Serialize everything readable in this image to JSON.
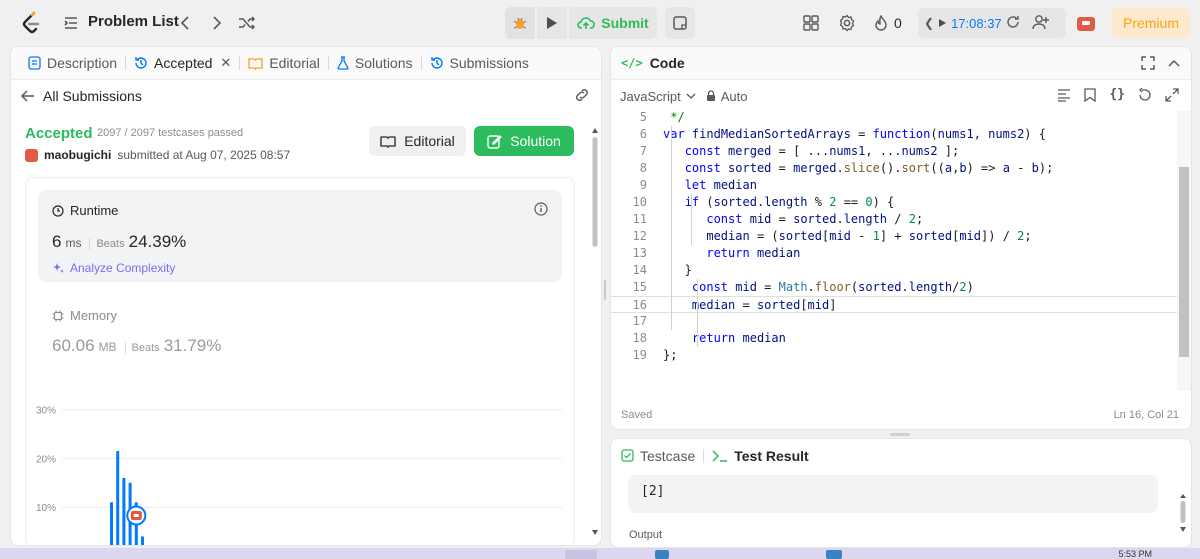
{
  "topbar": {
    "problem_list": "Problem List",
    "submit": "Submit",
    "streak_count": "0",
    "timer": "17:08:37",
    "premium": "Premium"
  },
  "left": {
    "tabs": [
      {
        "label": "Description"
      },
      {
        "label": "Accepted"
      },
      {
        "label": "Editorial"
      },
      {
        "label": "Solutions"
      },
      {
        "label": "Submissions"
      }
    ],
    "all_submissions": "All Submissions",
    "status": "Accepted",
    "testcases": "2097 / 2097 testcases passed",
    "username": "maobugichi",
    "submitted_at": "submitted at Aug 07, 2025 08:57",
    "editorial_btn": "Editorial",
    "solution_btn": "Solution",
    "runtime": {
      "title": "Runtime",
      "value": "6",
      "unit": "ms",
      "beats_label": "Beats",
      "beats": "24.39%",
      "analyze": "Analyze Complexity"
    },
    "memory": {
      "title": "Memory",
      "value": "60.06",
      "unit": "MB",
      "beats_label": "Beats",
      "beats": "31.79%"
    }
  },
  "chart_data": {
    "type": "bar",
    "y_ticks": [
      "30%",
      "20%",
      "10%"
    ],
    "ylim": [
      0,
      30
    ],
    "values": [
      11,
      21.5,
      16,
      15,
      11,
      4,
      1
    ],
    "your_submission_index": 4,
    "color": "#007aff"
  },
  "code": {
    "title": "Code",
    "language": "JavaScript",
    "mode": "Auto",
    "saved": "Saved",
    "position": "Ln 16, Col 21",
    "lines": [
      {
        "n": "5",
        "text": " */"
      },
      {
        "n": "6",
        "text": "var findMedianSortedArrays = function(nums1, nums2) {"
      },
      {
        "n": "7",
        "text": "   const merged = [ ...nums1, ...nums2 ];"
      },
      {
        "n": "8",
        "text": "   const sorted = merged.slice().sort((a,b) => a - b);"
      },
      {
        "n": "9",
        "text": "   let median"
      },
      {
        "n": "10",
        "text": "   if (sorted.length % 2 == 0) {"
      },
      {
        "n": "11",
        "text": "      const mid = sorted.length / 2;"
      },
      {
        "n": "12",
        "text": "      median = (sorted[mid - 1] + sorted[mid]) / 2;"
      },
      {
        "n": "13",
        "text": "      return median"
      },
      {
        "n": "14",
        "text": "   }"
      },
      {
        "n": "15",
        "text": "    const mid = Math.floor(sorted.length/2)"
      },
      {
        "n": "16",
        "text": "    median = sorted[mid]"
      },
      {
        "n": "17",
        "text": ""
      },
      {
        "n": "18",
        "text": "    return median"
      },
      {
        "n": "19",
        "text": "};"
      }
    ]
  },
  "test": {
    "testcase_tab": "Testcase",
    "result_tab": "Test Result",
    "result_value": "[2]",
    "output_label": "Output"
  },
  "taskbar": {
    "time": "5:53 PM"
  }
}
